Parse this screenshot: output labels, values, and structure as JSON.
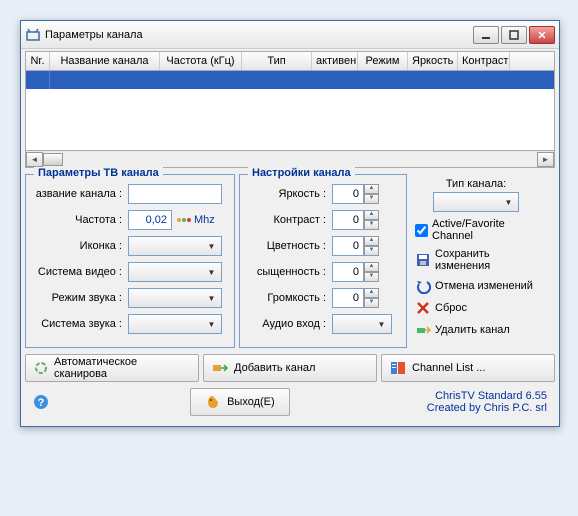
{
  "window": {
    "title": "Параметры канала"
  },
  "table": {
    "headers": [
      "Nr.",
      "Название канала",
      "Частота (кГц)",
      "Тип",
      "активен",
      "Режим",
      "Яркость",
      "Контраст"
    ]
  },
  "tvparams": {
    "title": "Параметры ТВ канала",
    "name_label": "азвание канала :",
    "freq_label": "Частота :",
    "freq_value": "0,02",
    "freq_unit": "Mhz",
    "icon_label": "Иконка :",
    "video_label": "Система видео :",
    "soundmode_label": "Режим звука :",
    "soundsys_label": "Система звука :"
  },
  "settings": {
    "title": "Настройки канала",
    "brightness_label": "Яркость :",
    "brightness_value": "0",
    "contrast_label": "Контраст :",
    "contrast_value": "0",
    "color_label": "Цветность :",
    "color_value": "0",
    "saturation_label": "сыщенность :",
    "saturation_value": "0",
    "volume_label": "Громкость :",
    "volume_value": "0",
    "audioin_label": "Аудио вход :"
  },
  "right": {
    "type_label": "Тип канала:",
    "active_label": "Active/Favorite Channel",
    "save_label": "Сохранить изменения",
    "cancel_label": "Отмена изменений",
    "reset_label": "Сброс",
    "delete_label": "Удалить канал"
  },
  "bottom": {
    "autoscan": "Автоматическое сканирова",
    "addchannel": "Добавить канал",
    "channellist": "Channel List ..."
  },
  "footer": {
    "exit": "Выход(E)",
    "line1": "ChrisTV Standard 6.55",
    "line2": "Created by Chris P.C. srl"
  }
}
